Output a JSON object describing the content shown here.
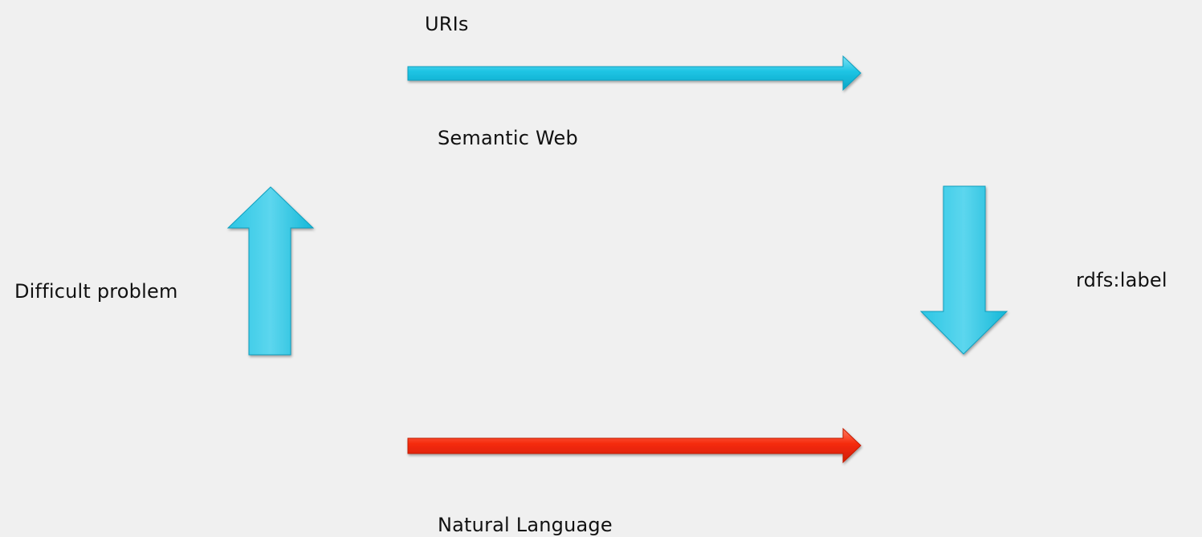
{
  "labels": {
    "top_arrow": "URIs",
    "top_level": "Semantic Web",
    "left_arrow": "Difficult problem",
    "right_arrow": "rdfs:label",
    "bottom_level": "Natural Language"
  },
  "colors": {
    "background": "#f0f0f0",
    "blue_arrow": "#1ec4e4",
    "red_arrow": "#f52a0c"
  }
}
